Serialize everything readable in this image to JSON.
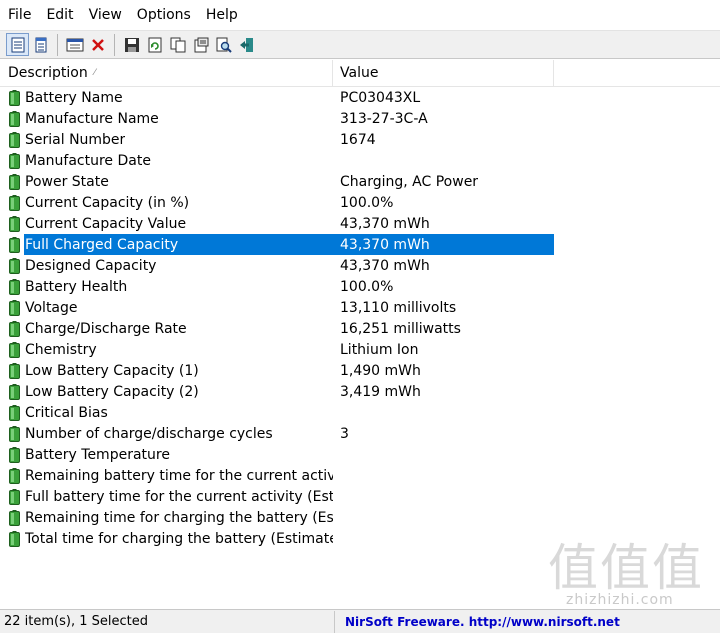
{
  "menu": [
    "File",
    "Edit",
    "View",
    "Options",
    "Help"
  ],
  "toolbar": {
    "icons": [
      "html-report-selected-icon",
      "html-report-all-icon",
      "properties-icon",
      "delete-icon",
      "save-icon",
      "refresh-icon",
      "copy-icon",
      "copy-html-icon",
      "find-icon",
      "exit-icon"
    ]
  },
  "columns": {
    "description": "Description",
    "value": "Value"
  },
  "rows": [
    {
      "description": "Battery Name",
      "value": "PC03043XL"
    },
    {
      "description": "Manufacture Name",
      "value": "313-27-3C-A"
    },
    {
      "description": "Serial Number",
      "value": " 1674"
    },
    {
      "description": "Manufacture Date",
      "value": ""
    },
    {
      "description": "Power State",
      "value": "Charging, AC Power"
    },
    {
      "description": "Current Capacity (in %)",
      "value": "100.0%"
    },
    {
      "description": "Current Capacity Value",
      "value": "43,370 mWh"
    },
    {
      "description": "Full Charged Capacity",
      "value": "43,370 mWh",
      "selected": true
    },
    {
      "description": "Designed Capacity",
      "value": "43,370 mWh"
    },
    {
      "description": "Battery Health",
      "value": "100.0%"
    },
    {
      "description": "Voltage",
      "value": "13,110 millivolts"
    },
    {
      "description": "Charge/Discharge Rate",
      "value": "16,251 milliwatts"
    },
    {
      "description": "Chemistry",
      "value": "Lithium Ion"
    },
    {
      "description": "Low Battery Capacity (1)",
      "value": "1,490 mWh"
    },
    {
      "description": "Low Battery Capacity (2)",
      "value": "3,419 mWh"
    },
    {
      "description": "Critical Bias",
      "value": ""
    },
    {
      "description": "Number of charge/discharge cycles",
      "value": "3"
    },
    {
      "description": "Battery Temperature",
      "value": ""
    },
    {
      "description": "Remaining battery time for the current activity (...",
      "value": ""
    },
    {
      "description": "Full battery time for the current activity (Estimat...",
      "value": ""
    },
    {
      "description": "Remaining time for charging the battery (Estim...",
      "value": ""
    },
    {
      "description": "Total  time for charging the battery (Estimated)",
      "value": ""
    }
  ],
  "status": {
    "count": "22 item(s), 1 Selected",
    "link": "NirSoft Freeware.  http://www.nirsoft.net"
  },
  "watermark": {
    "big": "值值值",
    "small": "zhizhizhi.com"
  },
  "colors": {
    "selection": "#0078d7",
    "battery_icon": "#2e8b2e",
    "link": "#0000c8"
  }
}
